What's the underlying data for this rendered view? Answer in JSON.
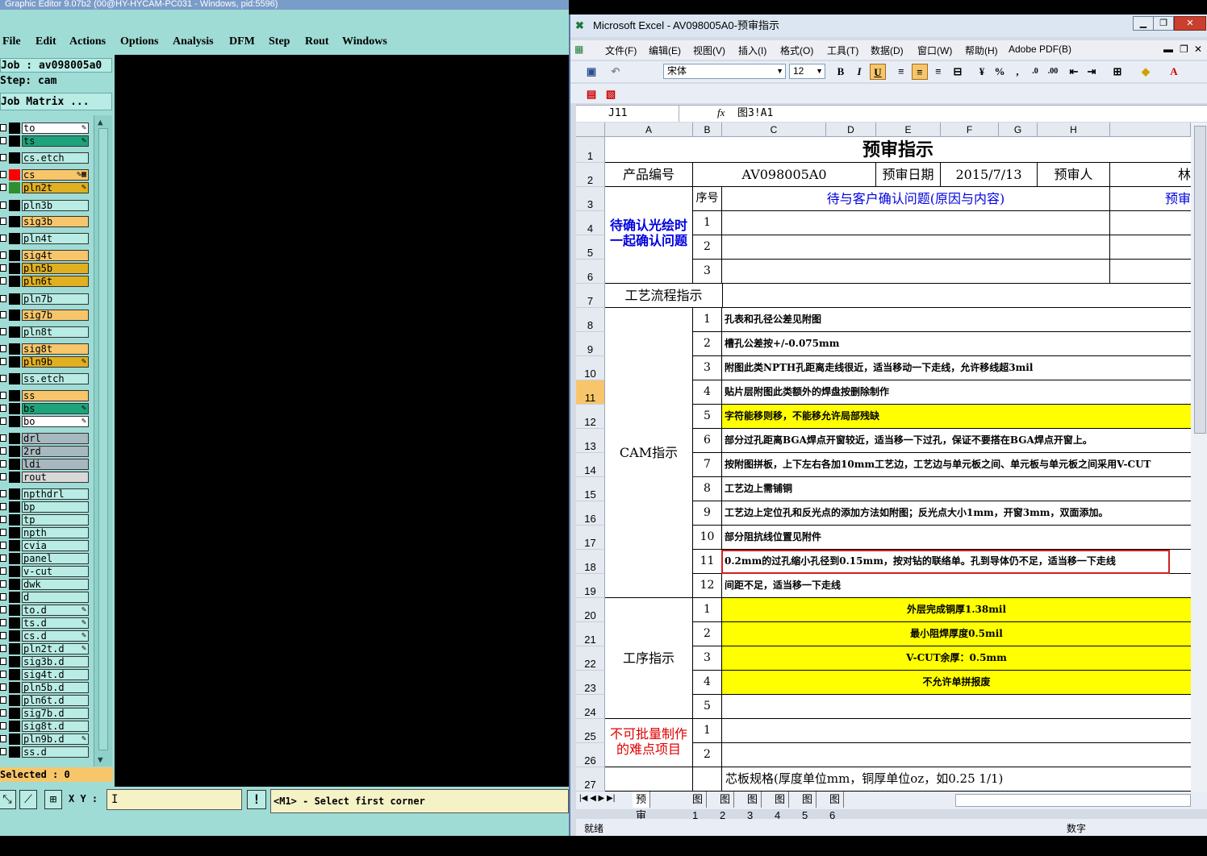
{
  "ge": {
    "title": "Graphic Editor 9.07b2 (00@HY-HYCAM-PC031 - Windows, pid:5596)",
    "menu": [
      "File",
      "Edit",
      "Actions",
      "Options",
      "Analysis",
      "DFM",
      "Step",
      "Rout",
      "Windows"
    ],
    "job": "Job : av098005a0",
    "step": "Step: cam",
    "matrix": "Job Matrix ...",
    "layers": [
      {
        "name": "to",
        "fill": "#ffffff",
        "mark": "✎"
      },
      {
        "name": "ts",
        "fill": "#1fa37a",
        "mark": "✎"
      },
      {
        "name": "cs.etch",
        "fill": "#b8ece4",
        "mark": ""
      },
      {
        "name": "cs",
        "fill": "#f7c66b",
        "mark": "✎▦",
        "sw": "#ff0000"
      },
      {
        "name": "pln2t",
        "fill": "#e0b020",
        "mark": "✎",
        "sw": "#2f8f2f"
      },
      {
        "name": "pln3b",
        "fill": "#b8ece4",
        "mark": ""
      },
      {
        "name": "sig3b",
        "fill": "#f7c66b",
        "mark": ""
      },
      {
        "name": "pln4t",
        "fill": "#b8ece4",
        "mark": ""
      },
      {
        "name": "sig4t",
        "fill": "#f7c66b",
        "mark": ""
      },
      {
        "name": "pln5b",
        "fill": "#e0b020",
        "mark": ""
      },
      {
        "name": "pln6t",
        "fill": "#e0b020",
        "mark": ""
      },
      {
        "name": "pln7b",
        "fill": "#b8ece4",
        "mark": ""
      },
      {
        "name": "sig7b",
        "fill": "#f7c66b",
        "mark": ""
      },
      {
        "name": "pln8t",
        "fill": "#b8ece4",
        "mark": ""
      },
      {
        "name": "sig8t",
        "fill": "#f7c66b",
        "mark": ""
      },
      {
        "name": "pln9b",
        "fill": "#e0b020",
        "mark": "✎"
      },
      {
        "name": "ss.etch",
        "fill": "#b8ece4",
        "mark": ""
      },
      {
        "name": "ss",
        "fill": "#f7c66b",
        "mark": ""
      },
      {
        "name": "bs",
        "fill": "#1fa37a",
        "mark": "✎"
      },
      {
        "name": "bo",
        "fill": "#ffffff",
        "mark": "✎"
      },
      {
        "name": "drl",
        "fill": "#a8b8c0",
        "mark": ""
      },
      {
        "name": "2rd",
        "fill": "#a8b8c0",
        "mark": ""
      },
      {
        "name": "ldi",
        "fill": "#a8b8c0",
        "mark": ""
      },
      {
        "name": "rout",
        "fill": "#d8d8d8",
        "mark": ""
      },
      {
        "name": "npthdrl",
        "fill": "#b8ece4",
        "mark": ""
      },
      {
        "name": "bp",
        "fill": "#b8ece4",
        "mark": ""
      },
      {
        "name": "tp",
        "fill": "#b8ece4",
        "mark": ""
      },
      {
        "name": "npth",
        "fill": "#b8ece4",
        "mark": ""
      },
      {
        "name": "cvia",
        "fill": "#b8ece4",
        "mark": ""
      },
      {
        "name": "panel",
        "fill": "#b8ece4",
        "mark": ""
      },
      {
        "name": "v-cut",
        "fill": "#b8ece4",
        "mark": ""
      },
      {
        "name": "dwk",
        "fill": "#b8ece4",
        "mark": ""
      },
      {
        "name": "d",
        "fill": "#b8ece4",
        "mark": ""
      },
      {
        "name": "to.d",
        "fill": "#b8ece4",
        "mark": "✎"
      },
      {
        "name": "ts.d",
        "fill": "#b8ece4",
        "mark": "✎"
      },
      {
        "name": "cs.d",
        "fill": "#b8ece4",
        "mark": "✎"
      },
      {
        "name": "pln2t.d",
        "fill": "#b8ece4",
        "mark": "✎"
      },
      {
        "name": "sig3b.d",
        "fill": "#b8ece4",
        "mark": ""
      },
      {
        "name": "sig4t.d",
        "fill": "#b8ece4",
        "mark": ""
      },
      {
        "name": "pln5b.d",
        "fill": "#b8ece4",
        "mark": ""
      },
      {
        "name": "pln6t.d",
        "fill": "#b8ece4",
        "mark": ""
      },
      {
        "name": "sig7b.d",
        "fill": "#b8ece4",
        "mark": ""
      },
      {
        "name": "sig8t.d",
        "fill": "#b8ece4",
        "mark": ""
      },
      {
        "name": "pln9b.d",
        "fill": "#b8ece4",
        "mark": "✎"
      },
      {
        "name": "ss.d",
        "fill": "#b8ece4",
        "mark": ""
      }
    ],
    "selected": "Selected : 0",
    "xy_label": "X Y :",
    "prompt": "<M1> - Select first corner"
  },
  "xl": {
    "title": "Microsoft Excel - AV098005A0-预审指示",
    "menu": [
      "文件(F)",
      "编辑(E)",
      "视图(V)",
      "插入(I)",
      "格式(O)",
      "工具(T)",
      "数据(D)",
      "窗口(W)",
      "帮助(H)",
      "Adobe PDF(B)"
    ],
    "font": "宋体",
    "size": "12",
    "namebox": "J11",
    "formula": "图3!A1",
    "cols": [
      "A",
      "B",
      "C",
      "D",
      "E",
      "F",
      "G",
      "H"
    ],
    "r1_title": "预审指示",
    "r2": {
      "a": "产品编号",
      "c": "AV098005A0",
      "e": "预审日期",
      "f": "2015/7/13",
      "h": "预审人",
      "i": "林"
    },
    "r3": {
      "b": "序号",
      "c": "待与客户确认问题(原因与内容)",
      "i": "预审"
    },
    "confirm_label": "待确认光绘时一起确认问题",
    "confirm_nums": [
      "1",
      "2",
      "3"
    ],
    "flow_label": "工艺流程指示",
    "cam_label": "CAM指示",
    "cam_items": [
      "孔表和孔径公差见附图",
      "槽孔公差按+/-0.075mm",
      "附图此类NPTH孔距离走线很近，适当移动一下走线，允许移线超3mil",
      "贴片层附图此类额外的焊盘按删除制作",
      "字符能移则移，不能移允许局部残缺",
      "部分过孔距离BGA焊点开窗较近，适当移一下过孔，保证不要搭在BGA焊点开窗上。",
      "按附图拼板，上下左右各加10mm工艺边，工艺边与单元板之间、单元板与单元板之间采用V-CUT",
      "工艺边上需铺铜",
      "工艺边上定位孔和反光点的添加方法如附图；反光点大小1mm，开窗3mm，双面添加。",
      "部分阻抗线位置见附件",
      "0.2mm的过孔缩小孔径到0.15mm，按对钻的联络单。孔到导体仍不足，适当移一下走线",
      "间距不足，适当移一下走线"
    ],
    "proc_label": "工序指示",
    "proc_items": [
      "外层完成铜厚1.38mil",
      "最小阻焊厚度0.5mil",
      "V-CUT余厚：0.5mm",
      "不允许单拼报废",
      ""
    ],
    "hard_label": "不可批量制作的难点项目",
    "hard_nums": [
      "1",
      "2"
    ],
    "r27": "芯板规格(厚度单位mm，铜厚单位oz，如0.25 1/1)",
    "tabs": [
      "预审指示",
      "图1",
      "图2",
      "图3",
      "图4",
      "图5",
      "图6"
    ],
    "status_left": "就绪",
    "status_right": "数字"
  }
}
